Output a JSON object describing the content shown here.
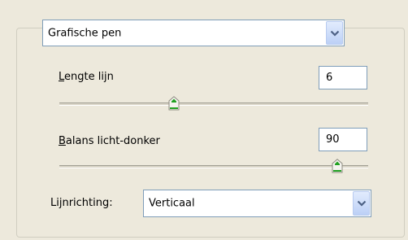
{
  "effect": {
    "selected": "Grafische pen",
    "icon": "chevron-down-icon"
  },
  "stroke_length": {
    "label_first": "L",
    "label_rest": "engte lijn",
    "value": "6",
    "slider_fraction": 0.37
  },
  "balance": {
    "label_first": "B",
    "label_rest": "alans licht-donker",
    "value": "90",
    "slider_fraction": 0.9
  },
  "direction": {
    "label": "Lijnrichting:",
    "selected": "Verticaal",
    "icon": "chevron-down-icon"
  },
  "colors": {
    "background": "#ede9dc",
    "field_border": "#7f9db9",
    "thumb_accent": "#21a121"
  }
}
